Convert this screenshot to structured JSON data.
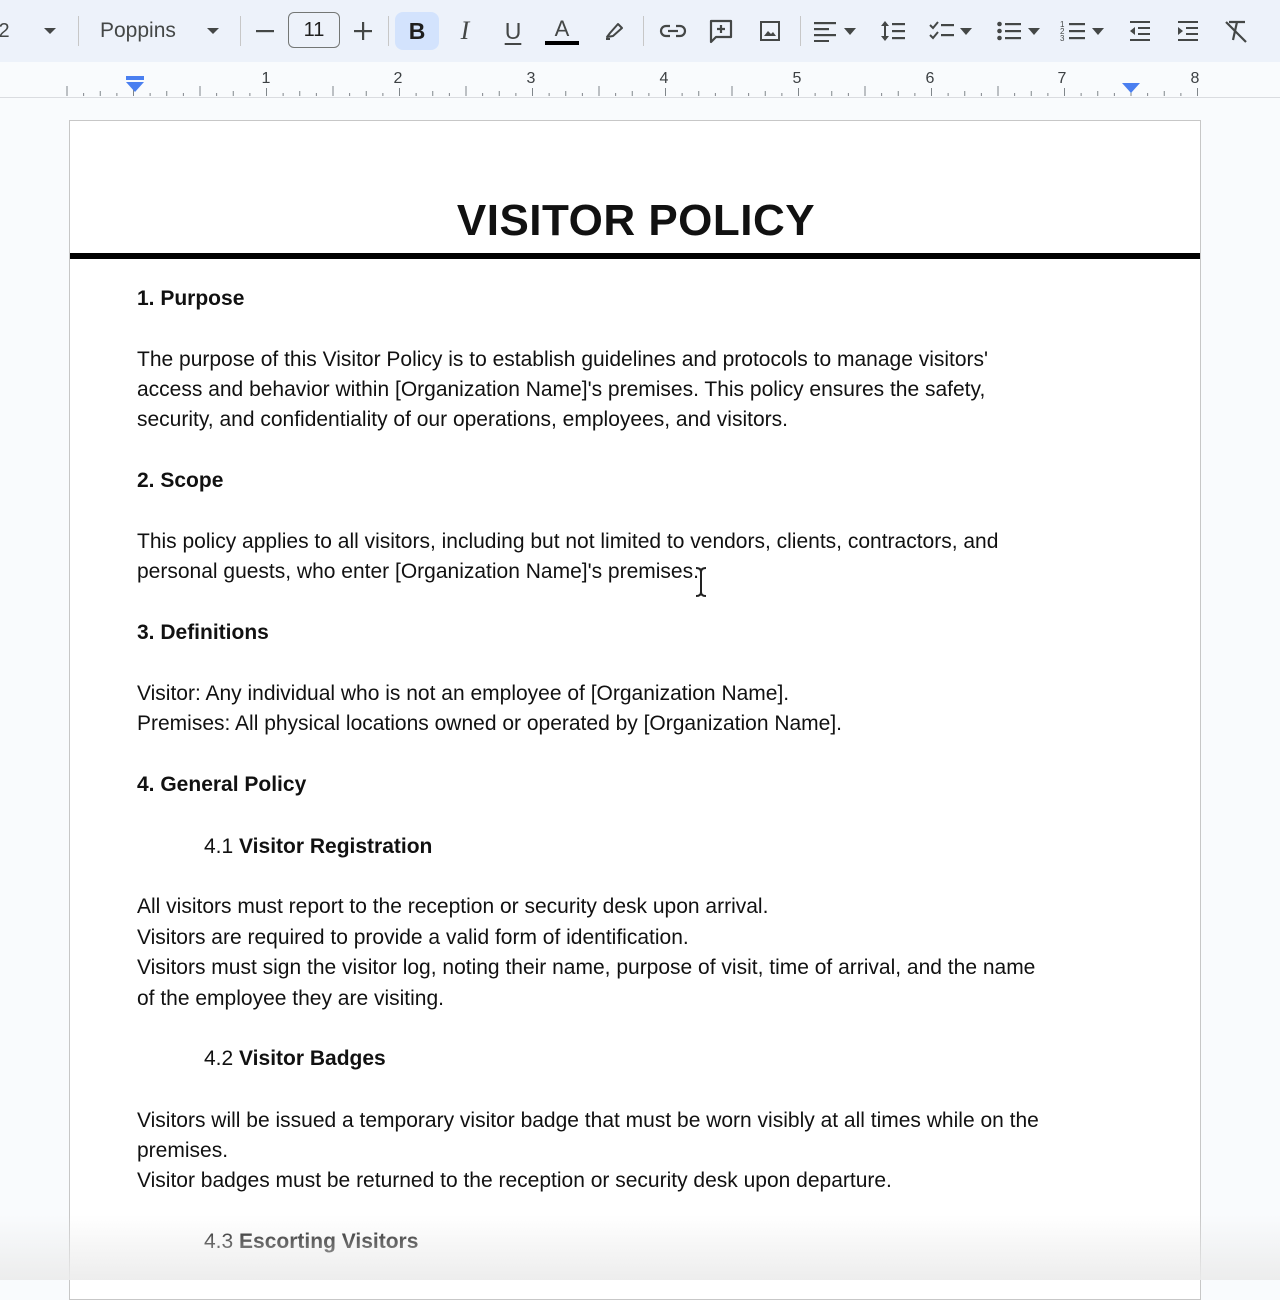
{
  "toolbar": {
    "style_dropdown_partial": "2",
    "font_name": "Poppins",
    "font_size": "11",
    "bold_label": "B",
    "italic_label": "I",
    "underline_label": "U",
    "text_color_label": "A"
  },
  "ruler": {
    "numbers": [
      "1",
      "2",
      "3",
      "4",
      "5",
      "6",
      "7",
      "8"
    ]
  },
  "document": {
    "title": "VISITOR POLICY",
    "lines": {
      "h1": "1. Purpose",
      "p1a": "The purpose of this Visitor Policy is to establish guidelines and protocols to manage visitors'",
      "p1b": "access and behavior within [Organization Name]'s premises. This policy ensures the safety,",
      "p1c": "security, and confidentiality of our operations, employees, and visitors.",
      "h2": "2. Scope",
      "p2a": "This policy applies to all visitors, including but not limited to vendors, clients, contractors, and",
      "p2b": "personal guests, who enter [Organization Name]'s premises.",
      "h3": "3. Definitions",
      "p3a": "Visitor: Any individual who is not an employee of [Organization Name].",
      "p3b": "Premises: All physical locations owned or operated by [Organization Name].",
      "h4": "4. General Policy",
      "s41_num": "4.1",
      "s41_title": "Visitor Registration",
      "p41a": "All visitors must report to the reception or security desk upon arrival.",
      "p41b": "Visitors are required to provide a valid form of identification.",
      "p41c": "Visitors must sign the visitor log, noting their name, purpose of visit, time of arrival, and the name",
      "p41d": "of the employee they are visiting.",
      "s42_num": "4.2",
      "s42_title": "Visitor Badges",
      "p42a": "Visitors will be issued a temporary visitor badge that must be worn visibly at all times while on the",
      "p42b": "premises.",
      "p42c": "Visitor badges must be returned to the reception or security desk upon departure.",
      "s43_num": "4.3",
      "s43_title": "Escorting Visitors"
    }
  },
  "colors": {
    "toolbar_bg": "#edf2fa",
    "active_button": "#d3e3fd",
    "ruler_marker": "#4a7ff0",
    "page_bg": "#ffffff"
  }
}
